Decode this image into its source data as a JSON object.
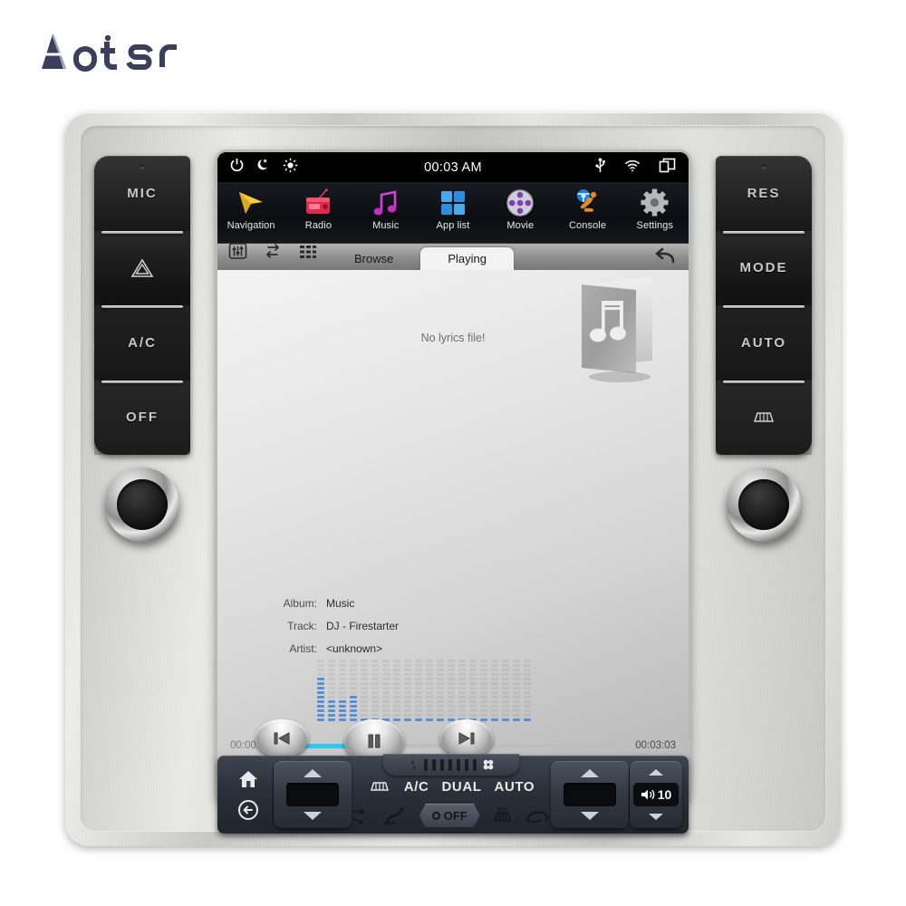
{
  "brand": {
    "name": "Aotsr"
  },
  "statusbar": {
    "clock": "00:03 AM",
    "left_icons": [
      {
        "name": "power-icon",
        "label": "Power"
      },
      {
        "name": "night-mode-icon",
        "label": "Night mode"
      },
      {
        "name": "brightness-icon",
        "label": "Brightness"
      }
    ],
    "right_icons": [
      {
        "name": "usb-icon",
        "label": "USB"
      },
      {
        "name": "wifi-icon",
        "label": "Wi-Fi"
      },
      {
        "name": "recent-apps-icon",
        "label": "Recent apps"
      }
    ]
  },
  "apps": [
    {
      "label": "Navigation",
      "icon": "navigation-arrow-icon"
    },
    {
      "label": "Radio",
      "icon": "radio-icon"
    },
    {
      "label": "Music",
      "icon": "music-note-icon"
    },
    {
      "label": "App list",
      "icon": "app-grid-icon"
    },
    {
      "label": "Movie",
      "icon": "film-reel-icon"
    },
    {
      "label": "Console",
      "icon": "steering-wheel-icon"
    },
    {
      "label": "Settings",
      "icon": "gear-icon"
    }
  ],
  "tabbar": {
    "tools": [
      {
        "name": "equalizer-icon",
        "label": "Equalizer"
      },
      {
        "name": "repeat-icon",
        "label": "Repeat"
      },
      {
        "name": "playlist-icon",
        "label": "Playlist"
      }
    ],
    "tabs": [
      {
        "label": "Browse",
        "active": false
      },
      {
        "label": "Playing",
        "active": true
      }
    ],
    "back_icon": "back-arrow-icon"
  },
  "player": {
    "lyrics_message": "No lyrics file!",
    "album_art_icon": "album-placeholder-music-icon",
    "elapsed": "00:00:54",
    "duration": "00:03:03",
    "progress_percent": 29,
    "accent_color": "#2ec9ef",
    "spectrum_color": "#5b8fd4",
    "spectrum_levels": [
      10,
      5,
      5,
      6,
      1,
      1,
      1,
      1,
      1,
      1,
      1,
      1,
      1,
      1,
      1,
      1,
      1,
      1,
      1,
      1
    ],
    "spectrum_max": 14,
    "meta": [
      {
        "key": "Album:",
        "value": "Music"
      },
      {
        "key": "Track:",
        "value": "DJ - Firestarter"
      },
      {
        "key": "Artist:",
        "value": "<unknown>"
      }
    ],
    "transport": [
      {
        "name": "previous-track-button",
        "label": "Previous"
      },
      {
        "name": "pause-button",
        "label": "Pause"
      },
      {
        "name": "next-track-button",
        "label": "Next"
      }
    ]
  },
  "bezel_left": [
    {
      "label": "MIC",
      "icon": "",
      "led": true
    },
    {
      "label": "",
      "icon": "hazard-triangle-icon",
      "led": false
    },
    {
      "label": "A/C",
      "icon": "",
      "led": false
    },
    {
      "label": "OFF",
      "icon": "",
      "led": false
    }
  ],
  "bezel_right": [
    {
      "label": "RES",
      "icon": "",
      "led": true
    },
    {
      "label": "MODE",
      "icon": "",
      "led": false
    },
    {
      "label": "AUTO",
      "icon": "",
      "led": false
    },
    {
      "label": "",
      "icon": "rear-defrost-icon",
      "led": false
    }
  ],
  "knobs": [
    {
      "name": "left-knob",
      "label": "Power / Volume knob"
    },
    {
      "name": "right-knob",
      "label": "Tune knob"
    }
  ],
  "climate": {
    "home_icon": "home-icon",
    "back_icon": "back-circle-icon",
    "labels": [
      "A/C",
      "DUAL",
      "AUTO"
    ],
    "off_label": "OFF",
    "fan_icon": "fan-icon",
    "icons": [
      {
        "name": "windshield-defrost-icon"
      },
      {
        "name": "airflow-arrows-icon"
      },
      {
        "name": "seat-airflow-icon"
      },
      {
        "name": "max-defrost-icon"
      },
      {
        "name": "recirculation-icon"
      }
    ],
    "volume_value": "10",
    "volume_icon": "speaker-icon"
  }
}
